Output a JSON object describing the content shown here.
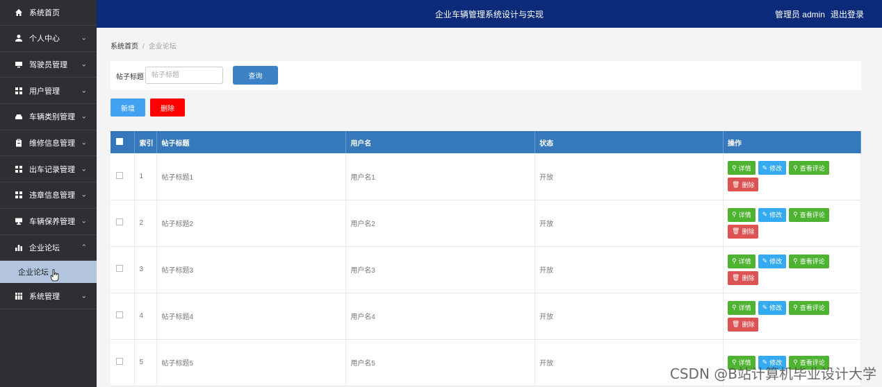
{
  "app": {
    "title": "企业车辆管理系统设计与实现",
    "user_label": "管理员 admin",
    "logout_label": "退出登录"
  },
  "sidebar": {
    "items": [
      {
        "label": "系统首页",
        "icon": "home-icon",
        "has_chevron": false
      },
      {
        "label": "个人中心",
        "icon": "user-icon",
        "has_chevron": true
      },
      {
        "label": "驾驶员管理",
        "icon": "monitor-icon",
        "has_chevron": true
      },
      {
        "label": "用户管理",
        "icon": "grid-icon",
        "has_chevron": true
      },
      {
        "label": "车辆类别管理",
        "icon": "car-icon",
        "has_chevron": true
      },
      {
        "label": "维修信息管理",
        "icon": "clipboard-icon",
        "has_chevron": true
      },
      {
        "label": "出车记录管理",
        "icon": "grid-icon",
        "has_chevron": true
      },
      {
        "label": "违章信息管理",
        "icon": "grid-icon",
        "has_chevron": true
      },
      {
        "label": "车辆保养管理",
        "icon": "computer-icon",
        "has_chevron": true
      },
      {
        "label": "企业论坛",
        "icon": "bar-chart-icon",
        "has_chevron": true,
        "expanded": true
      },
      {
        "label": "系统管理",
        "icon": "table-icon",
        "has_chevron": true
      }
    ],
    "sub_item": "企业论坛"
  },
  "breadcrumb": {
    "home": "系统首页",
    "current": "企业论坛"
  },
  "search": {
    "label": "帖子标题",
    "placeholder": "帖子标题",
    "button": "查询"
  },
  "actions": {
    "add": "新增",
    "delete": "删除"
  },
  "table": {
    "headers": [
      "索引",
      "帖子标题",
      "用户名",
      "状态",
      "操作"
    ],
    "rows": [
      {
        "index": "1",
        "title": "帖子标题1",
        "username": "用户名1",
        "status": "开放"
      },
      {
        "index": "2",
        "title": "帖子标题2",
        "username": "用户名2",
        "status": "开放"
      },
      {
        "index": "3",
        "title": "帖子标题3",
        "username": "用户名3",
        "status": "开放"
      },
      {
        "index": "4",
        "title": "帖子标题4",
        "username": "用户名4",
        "status": "开放"
      },
      {
        "index": "5",
        "title": "帖子标题5",
        "username": "用户名5",
        "status": "开放"
      }
    ],
    "ops": {
      "detail": "详情",
      "edit": "修改",
      "review": "查看评论",
      "remove": "删除"
    }
  },
  "watermark": "CSDN @B站计算机毕业设计大学"
}
